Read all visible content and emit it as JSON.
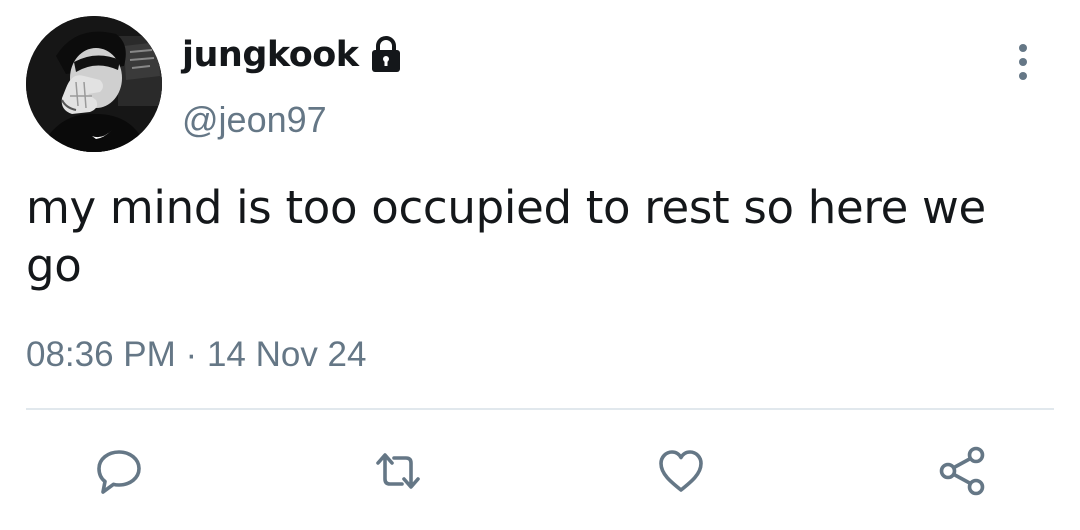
{
  "author": {
    "display_name": "jungkook",
    "handle": "@jeon97",
    "avatar_icon": "user-avatar-photo",
    "protected_icon": "lock-icon"
  },
  "tweet": {
    "text": "my mind is too occupied to rest so here we go",
    "time": "08:36 PM",
    "separator": "·",
    "date": "14 Nov 24"
  },
  "actions": [
    {
      "icon": "reply-icon"
    },
    {
      "icon": "retweet-icon"
    },
    {
      "icon": "like-icon"
    },
    {
      "icon": "share-icon"
    }
  ],
  "menu_icon": "more-vertical-icon",
  "colors": {
    "text": "#14171a",
    "secondary": "#657786",
    "divider": "#e1e8ed",
    "icon": "#657786"
  }
}
